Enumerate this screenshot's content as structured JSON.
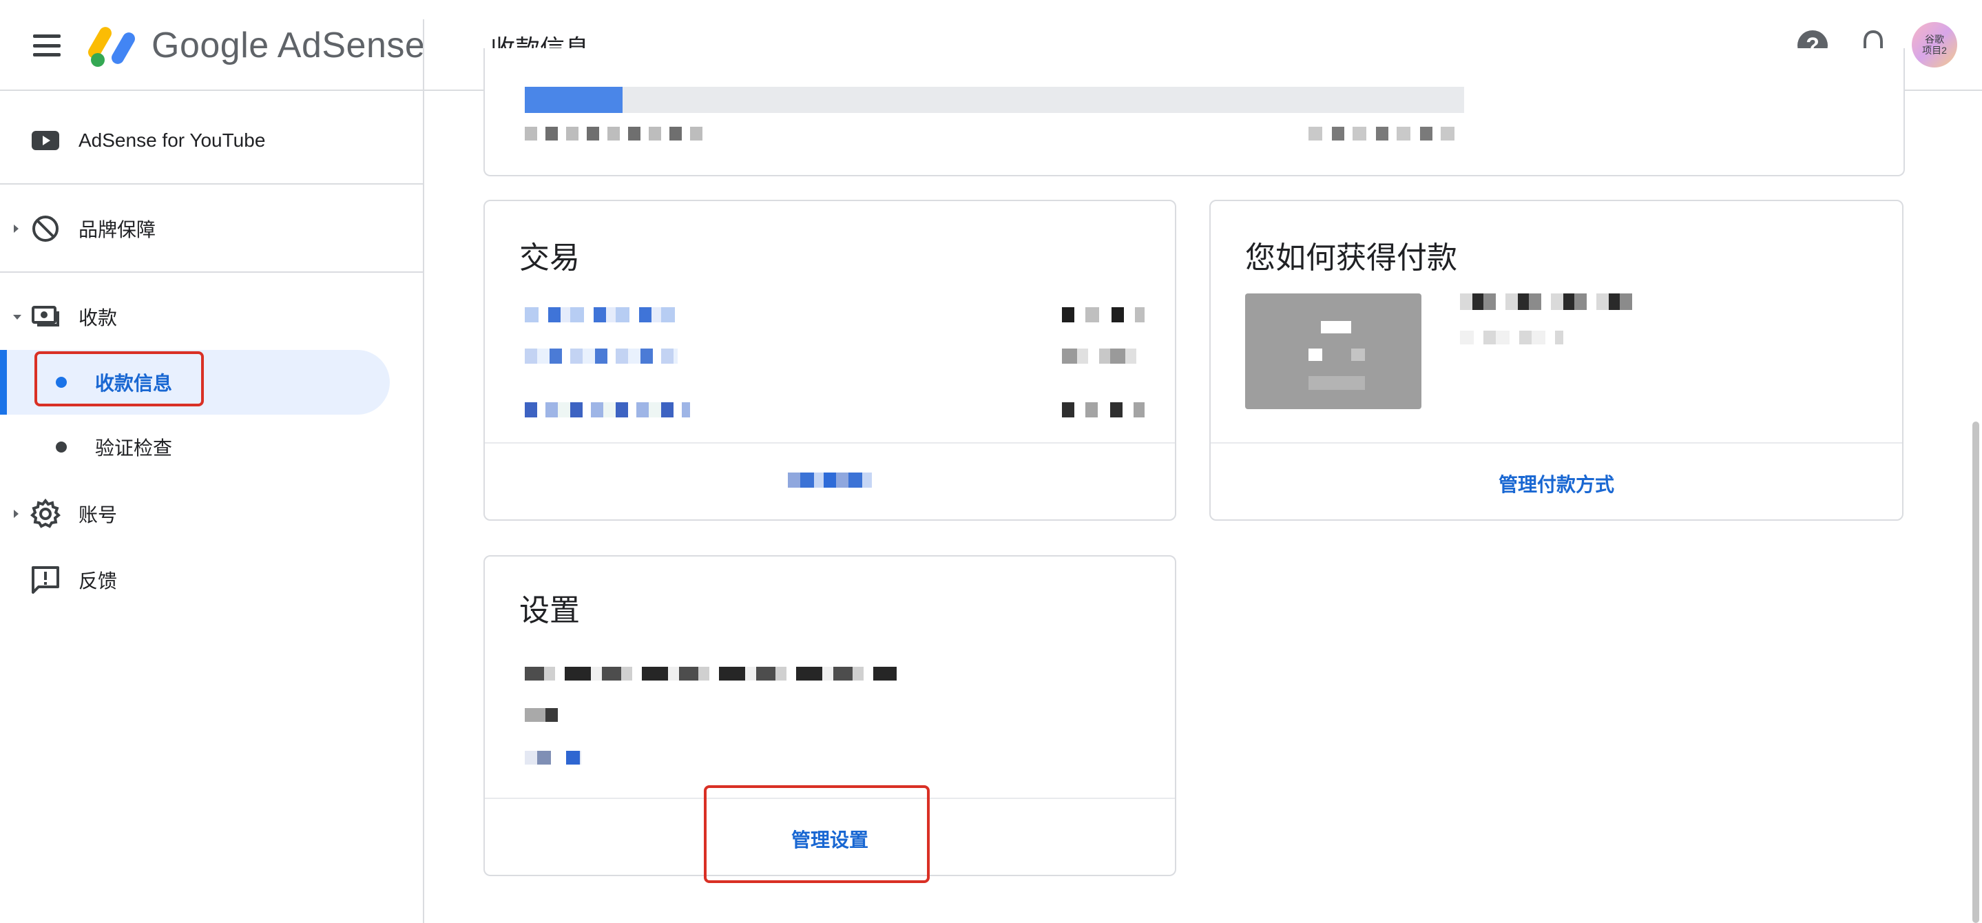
{
  "header": {
    "logo_text": "Google AdSense",
    "page_title": "收款信息",
    "avatar_line1": "谷歌",
    "avatar_line2": "项目2"
  },
  "sidebar": {
    "items": [
      {
        "label": "AdSense for YouTube",
        "icon": "youtube-icon"
      },
      {
        "label": "品牌保障",
        "icon": "block-icon"
      },
      {
        "label": "收款",
        "icon": "payments-icon"
      },
      {
        "label": "账号",
        "icon": "gear-icon"
      },
      {
        "label": "反馈",
        "icon": "feedback-icon"
      }
    ],
    "payments_sub": [
      {
        "label": "收款信息",
        "active": true
      },
      {
        "label": "验证检查",
        "active": false
      }
    ]
  },
  "cards": {
    "transactions": {
      "title": "交易"
    },
    "payment_method": {
      "title": "您如何获得付款",
      "action": "管理付款方式"
    },
    "settings": {
      "title": "设置",
      "action": "管理设置"
    }
  },
  "colors": {
    "accent": "#1a73e8",
    "highlight_red": "#d93025",
    "active_bg": "#e8f0fe"
  }
}
